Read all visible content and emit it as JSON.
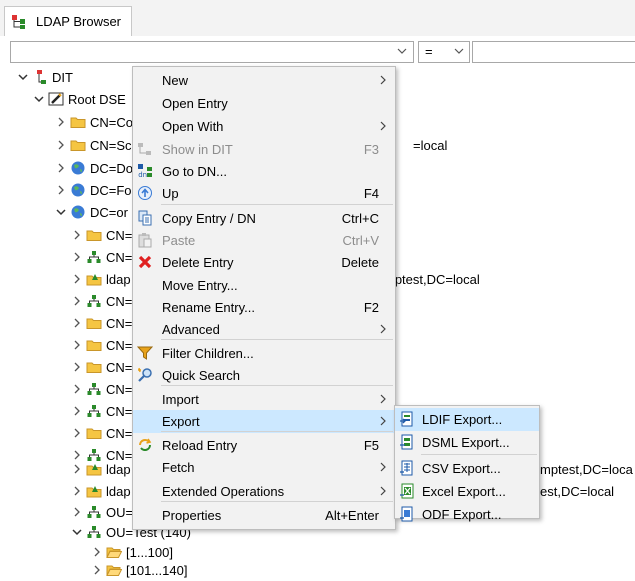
{
  "window": {
    "tab_title": "LDAP Browser"
  },
  "filter": {
    "operator": "="
  },
  "tree": {
    "root": "DIT",
    "root_dse": "Root DSE",
    "items": [
      {
        "label": "CN=Co",
        "tail": ""
      },
      {
        "label": "CN=Sc",
        "tail": "=local"
      },
      {
        "label": "DC=Do",
        "tail": ""
      },
      {
        "label": "DC=Fo",
        "tail": ""
      },
      {
        "label": "DC=or",
        "tail": ""
      },
      {
        "label": "CN=",
        "tail": ""
      },
      {
        "label": "CN=",
        "tail": ""
      },
      {
        "label": "ldap",
        "tail": "mptest,DC=local"
      },
      {
        "label": "CN=",
        "tail": ""
      },
      {
        "label": "CN=",
        "tail": ""
      },
      {
        "label": "CN=",
        "tail": ""
      },
      {
        "label": "CN=",
        "tail": ""
      },
      {
        "label": "CN=",
        "tail": ""
      },
      {
        "label": "CN=",
        "tail": ""
      },
      {
        "label": "CN=",
        "tail": ""
      },
      {
        "label": "CN=",
        "tail": ""
      },
      {
        "label": "CN=",
        "tail": ""
      },
      {
        "label": "CN=",
        "tail": ""
      },
      {
        "label": "CN=",
        "tail": ""
      },
      {
        "label": "ldap",
        "tail": "mptest,DC=loca"
      },
      {
        "label": "ldap",
        "tail": "est,DC=local"
      },
      {
        "label": "OU=",
        "tail": ""
      },
      {
        "label": "OU=Test (140)",
        "tail": ""
      },
      {
        "label": "[1...100]",
        "tail": ""
      },
      {
        "label": "[101...140]",
        "tail": ""
      }
    ]
  },
  "context_menu": {
    "items": [
      {
        "label": "New",
        "shortcut": "",
        "submenu": true,
        "disabled": false
      },
      {
        "label": "Open Entry",
        "shortcut": "",
        "submenu": false,
        "disabled": false
      },
      {
        "label": "Open With",
        "shortcut": "",
        "submenu": true,
        "disabled": false
      },
      {
        "label": "Show in DIT",
        "shortcut": "F3",
        "submenu": false,
        "disabled": true,
        "icon": "show-in-dit-icon"
      },
      {
        "label": "Go to DN...",
        "shortcut": "",
        "submenu": false,
        "disabled": false,
        "icon": "goto-dn-icon"
      },
      {
        "label": "Up",
        "shortcut": "F4",
        "submenu": false,
        "disabled": false,
        "icon": "up-icon"
      },
      {
        "label": "Copy Entry / DN",
        "shortcut": "Ctrl+C",
        "submenu": false,
        "disabled": false,
        "icon": "copy-icon"
      },
      {
        "label": "Paste",
        "shortcut": "Ctrl+V",
        "submenu": false,
        "disabled": true,
        "icon": "paste-icon"
      },
      {
        "label": "Delete Entry",
        "shortcut": "Delete",
        "submenu": false,
        "disabled": false,
        "icon": "delete-icon"
      },
      {
        "label": "Move Entry...",
        "shortcut": "",
        "submenu": false,
        "disabled": false
      },
      {
        "label": "Rename Entry...",
        "shortcut": "F2",
        "submenu": false,
        "disabled": false
      },
      {
        "label": "Advanced",
        "shortcut": "",
        "submenu": true,
        "disabled": false
      },
      {
        "label": "Filter Children...",
        "shortcut": "",
        "submenu": false,
        "disabled": false,
        "icon": "filter-icon"
      },
      {
        "label": "Quick Search",
        "shortcut": "",
        "submenu": false,
        "disabled": false,
        "icon": "quick-search-icon"
      },
      {
        "label": "Import",
        "shortcut": "",
        "submenu": true,
        "disabled": false
      },
      {
        "label": "Export",
        "shortcut": "",
        "submenu": true,
        "disabled": false,
        "highlighted": true
      },
      {
        "label": "Reload Entry",
        "shortcut": "F5",
        "submenu": false,
        "disabled": false,
        "icon": "reload-icon"
      },
      {
        "label": "Fetch",
        "shortcut": "",
        "submenu": true,
        "disabled": false
      },
      {
        "label": "Extended Operations",
        "shortcut": "",
        "submenu": true,
        "disabled": false
      },
      {
        "label": "Properties",
        "shortcut": "Alt+Enter",
        "submenu": false,
        "disabled": false
      }
    ]
  },
  "export_submenu": {
    "items": [
      {
        "label": "LDIF Export...",
        "icon": "ldif-export-icon",
        "highlighted": true
      },
      {
        "label": "DSML Export...",
        "icon": "dsml-export-icon"
      },
      {
        "label": "CSV Export...",
        "icon": "csv-export-icon"
      },
      {
        "label": "Excel Export...",
        "icon": "excel-export-icon"
      },
      {
        "label": "ODF Export...",
        "icon": "odf-export-icon"
      }
    ]
  },
  "colors": {
    "highlight": "#cce8ff",
    "menu_bg": "#f2f2f2",
    "disabled_text": "#8d8d8d",
    "folder": "#f5c542",
    "delete_red": "#e02020"
  }
}
